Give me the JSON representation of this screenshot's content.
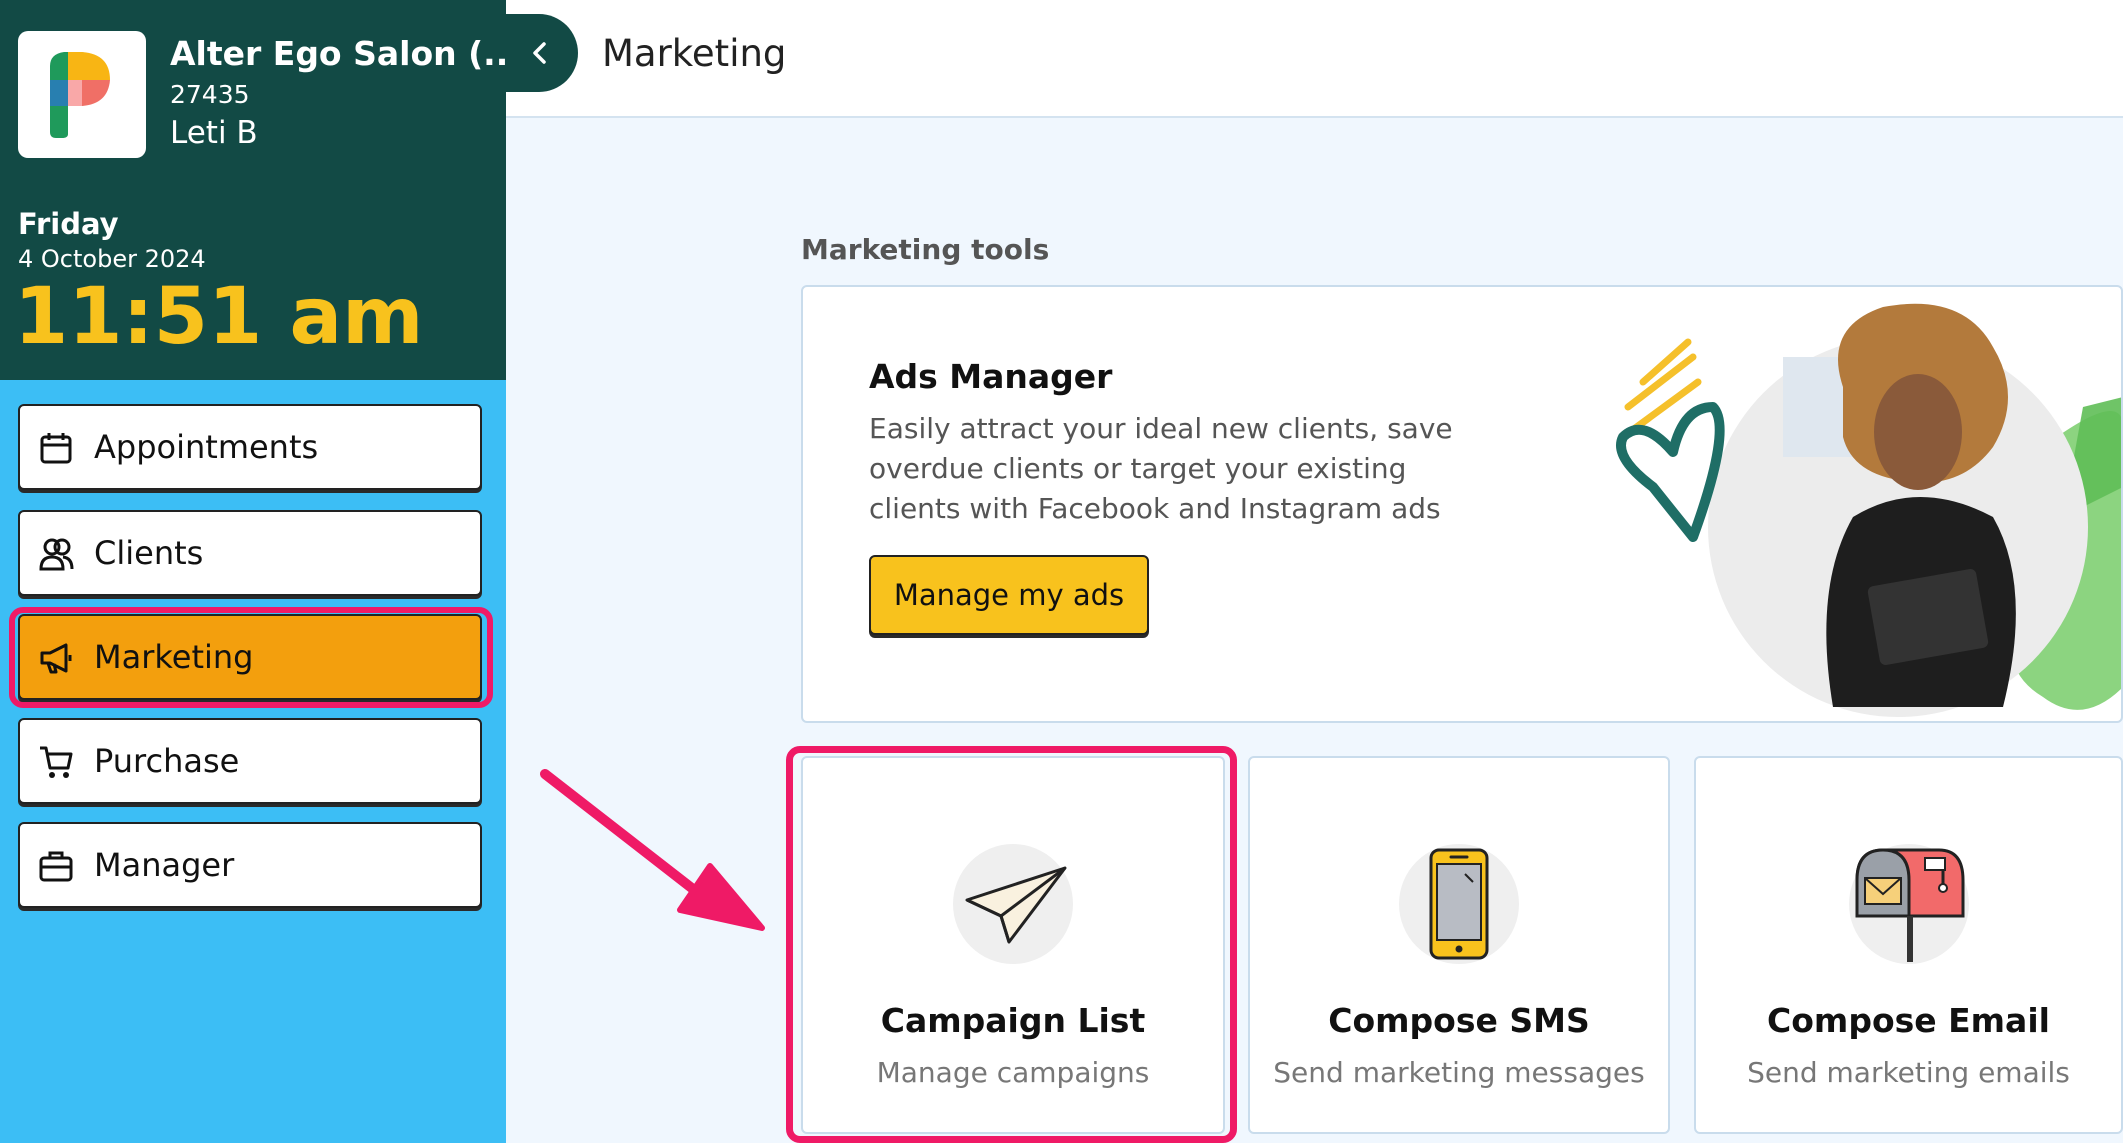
{
  "sidebar": {
    "salon_name": "Alter Ego Salon (...",
    "salon_id": "27435",
    "user_name": "Leti B",
    "day": "Friday",
    "date": "4 October 2024",
    "time": "11:51 am",
    "items": [
      {
        "label": "Appointments",
        "icon": "calendar-icon"
      },
      {
        "label": "Clients",
        "icon": "users-icon"
      },
      {
        "label": "Marketing",
        "icon": "megaphone-icon",
        "active": true
      },
      {
        "label": "Purchase",
        "icon": "cart-icon"
      },
      {
        "label": "Manager",
        "icon": "briefcase-icon"
      }
    ]
  },
  "header": {
    "title": "Marketing"
  },
  "main": {
    "section_title": "Marketing tools",
    "ads_manager": {
      "title": "Ads Manager",
      "description": "Easily attract your ideal new clients, save overdue clients or target your existing clients with Facebook and Instagram ads",
      "button_label": "Manage my ads"
    },
    "tools": [
      {
        "title": "Campaign List",
        "subtitle": "Manage campaigns",
        "icon": "paper-plane-icon"
      },
      {
        "title": "Compose SMS",
        "subtitle": "Send marketing messages",
        "icon": "phone-icon"
      },
      {
        "title": "Compose Email",
        "subtitle": "Send marketing emails",
        "icon": "mailbox-icon"
      }
    ]
  },
  "colors": {
    "sidebar_header": "#124a45",
    "sidebar_bg": "#3cbef5",
    "accent_yellow": "#f8c21d",
    "active_orange": "#f39f0d",
    "highlight_pink": "#ef1a66"
  }
}
